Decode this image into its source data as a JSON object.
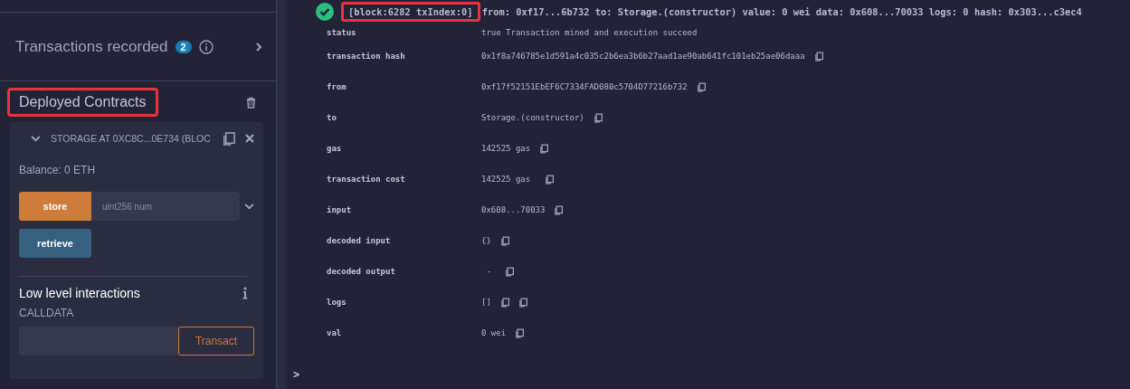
{
  "sidebar": {
    "transactions": {
      "label": "Transactions recorded",
      "count": "2"
    },
    "deployed": {
      "title": "Deployed Contracts",
      "highlighted": true
    },
    "contract": {
      "expanded": true,
      "name": "STORAGE AT 0XC8C...0E734 (BLOC",
      "balance": "Balance: 0 ETH",
      "functions": [
        {
          "kind": "transact",
          "label": "store",
          "placeholder": "uint256 num"
        },
        {
          "kind": "call",
          "label": "retrieve"
        }
      ],
      "low_level": {
        "title": "Low level interactions",
        "calldata_label": "CALLDATA",
        "button": "Transact"
      }
    }
  },
  "terminal": {
    "header": {
      "block": "[block:6282 txIndex:0]",
      "block_highlighted": true,
      "summary": "from: 0xf17...6b732 to: Storage.(constructor) value: 0 wei data: 0x608...70033 logs: 0 hash: 0x303...c3ec4"
    },
    "rows": [
      {
        "label": "status",
        "value": "true Transaction mined and execution succeed",
        "kind": "plain"
      },
      {
        "label": "transaction hash",
        "value": "0x1f8a746785e1d591a4c035c2b6ea3b6b27aad1ae90ab641fc101eb25ae06daaa",
        "kind": "copy"
      },
      {
        "label": "from",
        "value": "0xf17f52151EbEF6C7334FAD080c5704D77216b732",
        "kind": "copy"
      },
      {
        "label": "to",
        "value": "Storage.(constructor)",
        "kind": "copy"
      },
      {
        "label": "gas",
        "value": "142525 gas",
        "kind": "copy"
      },
      {
        "label": "transaction cost",
        "value": "142525 gas ",
        "kind": "copy"
      },
      {
        "label": "input",
        "value": "0x608...70033",
        "kind": "copy"
      },
      {
        "label": "decoded input",
        "value": "{}",
        "kind": "copy"
      },
      {
        "label": "decoded output",
        "value": " - ",
        "kind": "copy"
      },
      {
        "label": "logs",
        "value": "[]",
        "kind": "double-copy"
      },
      {
        "label": "val",
        "value": "0 wei",
        "kind": "copy"
      }
    ],
    "prompt": ">"
  }
}
